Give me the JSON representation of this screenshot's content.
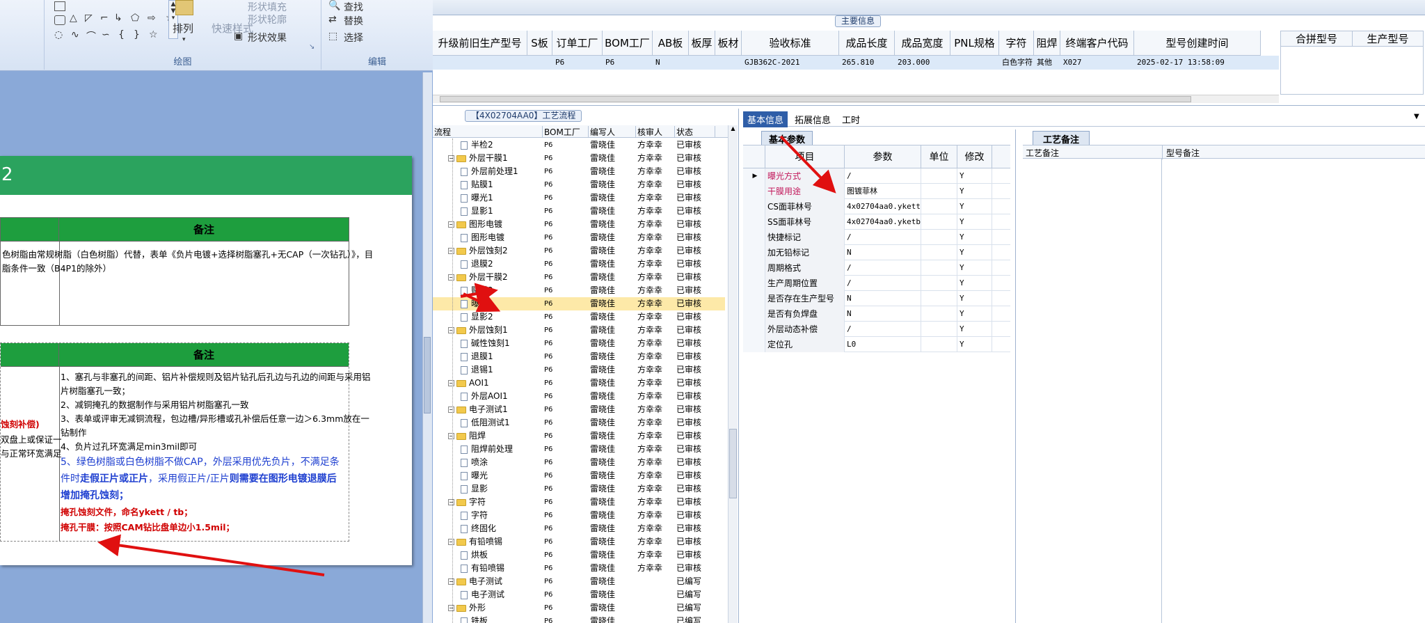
{
  "ribbon": {
    "shape_fill": "形状填充",
    "shape_outline": "形状轮廓",
    "shape_effect": "形状效果",
    "arrange": "排列",
    "quick_style": "快速样式",
    "find": "查找",
    "replace": "替换",
    "select": "选择",
    "group_drawing": "绘图",
    "group_edit": "编辑"
  },
  "doc": {
    "title_fragment": "2",
    "table1_header": "备注",
    "table1_lines": [
      "色树脂由常规树脂（白色树脂）代替，表单《负片电镀+选择树脂塞孔+无CAP（一次钻孔）》，目",
      "脂条件一致（B4P1的除外）"
    ],
    "table2_header": "备注",
    "table2_left_red": "蚀刻补偿)",
    "table2_left_lines": [
      "双盘上或保证一",
      "与正常环宽满足"
    ],
    "table2_lines": [
      "1、塞孔与非塞孔的间距、铝片补偿规则及铝片钻孔后孔边与孔边的间距与采用铝",
      "片树脂塞孔一致；",
      "2、减铜掩孔的数据制作与采用铝片树脂塞孔一致",
      "3、表单或评审无减铜流程，包边槽/异形槽或孔补偿后任意一边＞6.3mm放在一",
      "钻制作",
      "4、负片过孔环宽满足min3mil即可"
    ],
    "table2_blue_line1": "5、绿色树脂或白色树脂不做CAP，外层采用优先负片，不满足条",
    "table2_blue_line2a": "件时",
    "table2_blue_line2b": "走假正片或正片",
    "table2_blue_line2c": "，采用假正片/正片",
    "table2_blue_line2d": "则需要在图形电镀退膜后",
    "table2_blue_line3": "增加掩孔蚀刻；",
    "table2_red_line1": "掩孔蚀刻文件，命名ykett / tb；",
    "table2_red_line2": "掩孔干膜：按照CAM钻比盘单边小1.5mil；"
  },
  "main_info": {
    "caption": "主要信息",
    "columns": [
      "升级前旧生产型号",
      "S板",
      "订单工厂",
      "BOM工厂",
      "AB板",
      "板厚",
      "板材",
      "验收标准",
      "成品长度",
      "成品宽度",
      "PNL规格",
      "字符",
      "阻焊",
      "终端客户代码",
      "型号创建时间"
    ],
    "row": [
      "",
      "",
      "P6",
      "P6",
      "N",
      "",
      "",
      "GJB362C-2021",
      "265.810",
      "203.000",
      "",
      "白色字符",
      "其他",
      "X027",
      "2025-02-17 13:58:09"
    ],
    "right_columns": [
      "合拼型号",
      "生产型号"
    ]
  },
  "process": {
    "caption": "【4X02704AA0】工艺流程",
    "columns": [
      "流程",
      "BOM工厂",
      "编写人",
      "核审人",
      "状态"
    ],
    "rows": [
      {
        "level": 2,
        "type": "doc",
        "name": "半检2",
        "bom": "P6",
        "writer": "雷晓佳",
        "checker": "方幸幸",
        "status": "已审核"
      },
      {
        "level": 1,
        "type": "folder",
        "name": "外层干膜1",
        "bom": "P6",
        "writer": "雷晓佳",
        "checker": "方幸幸",
        "status": "已审核"
      },
      {
        "level": 2,
        "type": "doc",
        "name": "外层前处理1",
        "bom": "P6",
        "writer": "雷晓佳",
        "checker": "方幸幸",
        "status": "已审核"
      },
      {
        "level": 2,
        "type": "doc",
        "name": "贴膜1",
        "bom": "P6",
        "writer": "雷晓佳",
        "checker": "方幸幸",
        "status": "已审核"
      },
      {
        "level": 2,
        "type": "doc",
        "name": "曝光1",
        "bom": "P6",
        "writer": "雷晓佳",
        "checker": "方幸幸",
        "status": "已审核"
      },
      {
        "level": 2,
        "type": "doc",
        "name": "显影1",
        "bom": "P6",
        "writer": "雷晓佳",
        "checker": "方幸幸",
        "status": "已审核"
      },
      {
        "level": 1,
        "type": "folder",
        "name": "图形电镀",
        "bom": "P6",
        "writer": "雷晓佳",
        "checker": "方幸幸",
        "status": "已审核"
      },
      {
        "level": 2,
        "type": "doc",
        "name": "图形电镀",
        "bom": "P6",
        "writer": "雷晓佳",
        "checker": "方幸幸",
        "status": "已审核"
      },
      {
        "level": 1,
        "type": "folder",
        "name": "外层蚀刻2",
        "bom": "P6",
        "writer": "雷晓佳",
        "checker": "方幸幸",
        "status": "已审核"
      },
      {
        "level": 2,
        "type": "doc",
        "name": "退膜2",
        "bom": "P6",
        "writer": "雷晓佳",
        "checker": "方幸幸",
        "status": "已审核"
      },
      {
        "level": 1,
        "type": "folder",
        "name": "外层干膜2",
        "bom": "P6",
        "writer": "雷晓佳",
        "checker": "方幸幸",
        "status": "已审核"
      },
      {
        "level": 2,
        "type": "doc",
        "name": "贴膜2",
        "bom": "P6",
        "writer": "雷晓佳",
        "checker": "方幸幸",
        "status": "已审核"
      },
      {
        "level": 2,
        "type": "doc",
        "name": "曝光2",
        "bom": "P6",
        "writer": "雷晓佳",
        "checker": "方幸幸",
        "status": "已审核",
        "selected": true
      },
      {
        "level": 2,
        "type": "doc",
        "name": "显影2",
        "bom": "P6",
        "writer": "雷晓佳",
        "checker": "方幸幸",
        "status": "已审核"
      },
      {
        "level": 1,
        "type": "folder",
        "name": "外层蚀刻1",
        "bom": "P6",
        "writer": "雷晓佳",
        "checker": "方幸幸",
        "status": "已审核"
      },
      {
        "level": 2,
        "type": "doc",
        "name": "碱性蚀刻1",
        "bom": "P6",
        "writer": "雷晓佳",
        "checker": "方幸幸",
        "status": "已审核"
      },
      {
        "level": 2,
        "type": "doc",
        "name": "退膜1",
        "bom": "P6",
        "writer": "雷晓佳",
        "checker": "方幸幸",
        "status": "已审核"
      },
      {
        "level": 2,
        "type": "doc",
        "name": "退锡1",
        "bom": "P6",
        "writer": "雷晓佳",
        "checker": "方幸幸",
        "status": "已审核"
      },
      {
        "level": 1,
        "type": "folder",
        "name": "AOI1",
        "bom": "P6",
        "writer": "雷晓佳",
        "checker": "方幸幸",
        "status": "已审核"
      },
      {
        "level": 2,
        "type": "doc",
        "name": "外层AOI1",
        "bom": "P6",
        "writer": "雷晓佳",
        "checker": "方幸幸",
        "status": "已审核"
      },
      {
        "level": 1,
        "type": "folder",
        "name": "电子测试1",
        "bom": "P6",
        "writer": "雷晓佳",
        "checker": "方幸幸",
        "status": "已审核"
      },
      {
        "level": 2,
        "type": "doc",
        "name": "低阻测试1",
        "bom": "P6",
        "writer": "雷晓佳",
        "checker": "方幸幸",
        "status": "已审核"
      },
      {
        "level": 1,
        "type": "folder",
        "name": "阻焊",
        "bom": "P6",
        "writer": "雷晓佳",
        "checker": "方幸幸",
        "status": "已审核"
      },
      {
        "level": 2,
        "type": "doc",
        "name": "阻焊前处理",
        "bom": "P6",
        "writer": "雷晓佳",
        "checker": "方幸幸",
        "status": "已审核"
      },
      {
        "level": 2,
        "type": "doc",
        "name": "喷涂",
        "bom": "P6",
        "writer": "雷晓佳",
        "checker": "方幸幸",
        "status": "已审核"
      },
      {
        "level": 2,
        "type": "doc",
        "name": "曝光",
        "bom": "P6",
        "writer": "雷晓佳",
        "checker": "方幸幸",
        "status": "已审核"
      },
      {
        "level": 2,
        "type": "doc",
        "name": "显影",
        "bom": "P6",
        "writer": "雷晓佳",
        "checker": "方幸幸",
        "status": "已审核"
      },
      {
        "level": 1,
        "type": "folder",
        "name": "字符",
        "bom": "P6",
        "writer": "雷晓佳",
        "checker": "方幸幸",
        "status": "已审核"
      },
      {
        "level": 2,
        "type": "doc",
        "name": "字符",
        "bom": "P6",
        "writer": "雷晓佳",
        "checker": "方幸幸",
        "status": "已审核"
      },
      {
        "level": 2,
        "type": "doc",
        "name": "终固化",
        "bom": "P6",
        "writer": "雷晓佳",
        "checker": "方幸幸",
        "status": "已审核"
      },
      {
        "level": 1,
        "type": "folder",
        "name": "有铅喷锡",
        "bom": "P6",
        "writer": "雷晓佳",
        "checker": "方幸幸",
        "status": "已审核"
      },
      {
        "level": 2,
        "type": "doc",
        "name": "烘板",
        "bom": "P6",
        "writer": "雷晓佳",
        "checker": "方幸幸",
        "status": "已审核"
      },
      {
        "level": 2,
        "type": "doc",
        "name": "有铅喷锡",
        "bom": "P6",
        "writer": "雷晓佳",
        "checker": "方幸幸",
        "status": "已审核"
      },
      {
        "level": 1,
        "type": "folder",
        "name": "电子测试",
        "bom": "P6",
        "writer": "雷晓佳",
        "checker": "",
        "status": "已编写"
      },
      {
        "level": 2,
        "type": "doc",
        "name": "电子测试",
        "bom": "P6",
        "writer": "雷晓佳",
        "checker": "",
        "status": "已编写"
      },
      {
        "level": 1,
        "type": "folder",
        "name": "外形",
        "bom": "P6",
        "writer": "雷晓佳",
        "checker": "",
        "status": "已编写"
      },
      {
        "level": 2,
        "type": "doc",
        "name": "铣板",
        "bom": "P6",
        "writer": "雷晓佳",
        "checker": "",
        "status": "已编写"
      }
    ]
  },
  "detail": {
    "tabs": [
      "基本信息",
      "拓展信息",
      "工时"
    ],
    "subtab": "基本参数",
    "columns": [
      "项目",
      "参数",
      "单位",
      "修改"
    ],
    "rows": [
      {
        "item": "曝光方式",
        "param": "/",
        "unit": "",
        "edit": "Y",
        "color": "#c2185b"
      },
      {
        "item": "干膜用途",
        "param": "图镀菲林",
        "unit": "",
        "edit": "Y",
        "color": "#c2185b"
      },
      {
        "item": "CS面菲林号",
        "param": "4x02704aa0.ykett",
        "unit": "",
        "edit": "Y",
        "color": "#000000"
      },
      {
        "item": "SS面菲林号",
        "param": "4x02704aa0.yketb",
        "unit": "",
        "edit": "Y",
        "color": "#000000"
      },
      {
        "item": "快捷标记",
        "param": "/",
        "unit": "",
        "edit": "Y",
        "color": "#000000"
      },
      {
        "item": "加无铅标记",
        "param": "N",
        "unit": "",
        "edit": "Y",
        "color": "#000000"
      },
      {
        "item": "周期格式",
        "param": "/",
        "unit": "",
        "edit": "Y",
        "color": "#000000"
      },
      {
        "item": "生产周期位置",
        "param": "/",
        "unit": "",
        "edit": "Y",
        "color": "#000000"
      },
      {
        "item": "是否存在生产型号",
        "param": "N",
        "unit": "",
        "edit": "Y",
        "color": "#000000"
      },
      {
        "item": "是否有负焊盘",
        "param": "N",
        "unit": "",
        "edit": "Y",
        "color": "#000000"
      },
      {
        "item": "外层动态补偿",
        "param": "/",
        "unit": "",
        "edit": "Y",
        "color": "#000000"
      },
      {
        "item": "定位孔",
        "param": "L0",
        "unit": "",
        "edit": "Y",
        "color": "#000000"
      }
    ]
  },
  "notes": {
    "tab": "工艺备注",
    "columns": [
      "工艺备注",
      "型号备注"
    ]
  },
  "colors": {
    "annotation_arrow": "#e01010",
    "accent_green": "#2ba35e",
    "selected_row": "#fde9a8",
    "tab_blue": "#2f5ea8"
  }
}
